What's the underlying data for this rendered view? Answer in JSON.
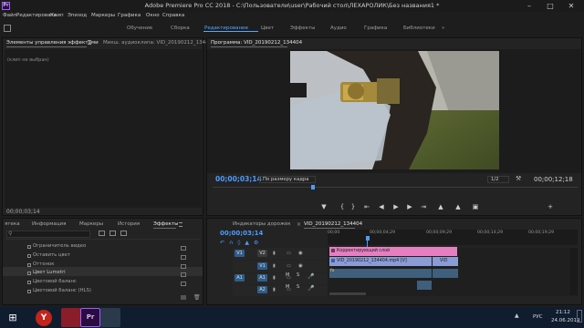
{
  "window": {
    "title": "Adobe Premiere Pro CC 2018 - C:\\Пользователи\\user\\Рабочий стол\\ЛЕХАРОЛИК\\Без названия1 *"
  },
  "menu": [
    "Файл",
    "Редактировать",
    "Клип",
    "Эпизод",
    "Маркеры",
    "Графика",
    "Окно",
    "Справка"
  ],
  "workspaces": [
    "Обучение",
    "Сборка",
    "Редактирование",
    "Цвет",
    "Эффекты",
    "Аудио",
    "Графика",
    "Библиотеки"
  ],
  "workspace_more": "»",
  "effects_panel": {
    "tab_label": "Элементы управления эффектами",
    "tab2_label": "Микш. аудиоклипа: VID_20190212_1344",
    "no_clip": "(клип не выбран)",
    "time": "00;00;03;14"
  },
  "program": {
    "tab_label": "Программа: VID_20190212_134404",
    "timecode": "00;00;03;14",
    "fit": "По размеру кадра",
    "resolution": "1/2",
    "duration": "00;00;12;18"
  },
  "project_tabs": [
    "ятека",
    "Информация",
    "Маркеры",
    "История",
    "Эффекты"
  ],
  "effects_list": [
    {
      "label": "Ограничитель видео",
      "checked": false
    },
    {
      "label": "Оставить цвет",
      "checked": false
    },
    {
      "label": "Оттенок",
      "checked": false
    },
    {
      "label": "Цвет Lumetri",
      "checked": true
    },
    {
      "label": "Цветовой баланс",
      "checked": false
    },
    {
      "label": "Цветовой баланс (HLS)",
      "checked": false
    }
  ],
  "timeline": {
    "tab1": "Индикаторы дорожек",
    "tab2": "VID_20190212_134404",
    "timecode": "00;00;03;14",
    "ruler": [
      "00;00",
      "00;00;04;29",
      "00;00;09;29",
      "00;00;14;29",
      "00;00;19;29"
    ],
    "tracks": [
      "V2",
      "V1",
      "A1",
      "A2"
    ],
    "src": [
      "V1",
      "A1"
    ],
    "mute": "M",
    "solo": "S",
    "clips": [
      {
        "label": "Корректирующий слой"
      },
      {
        "label": "VID_20190212_134404.mp4 [V]"
      },
      {
        "label": "VID"
      }
    ],
    "fx_badge": "fx"
  },
  "taskbar": {
    "lang": "РУС",
    "time": "21:12",
    "date": "24.06.2019"
  }
}
